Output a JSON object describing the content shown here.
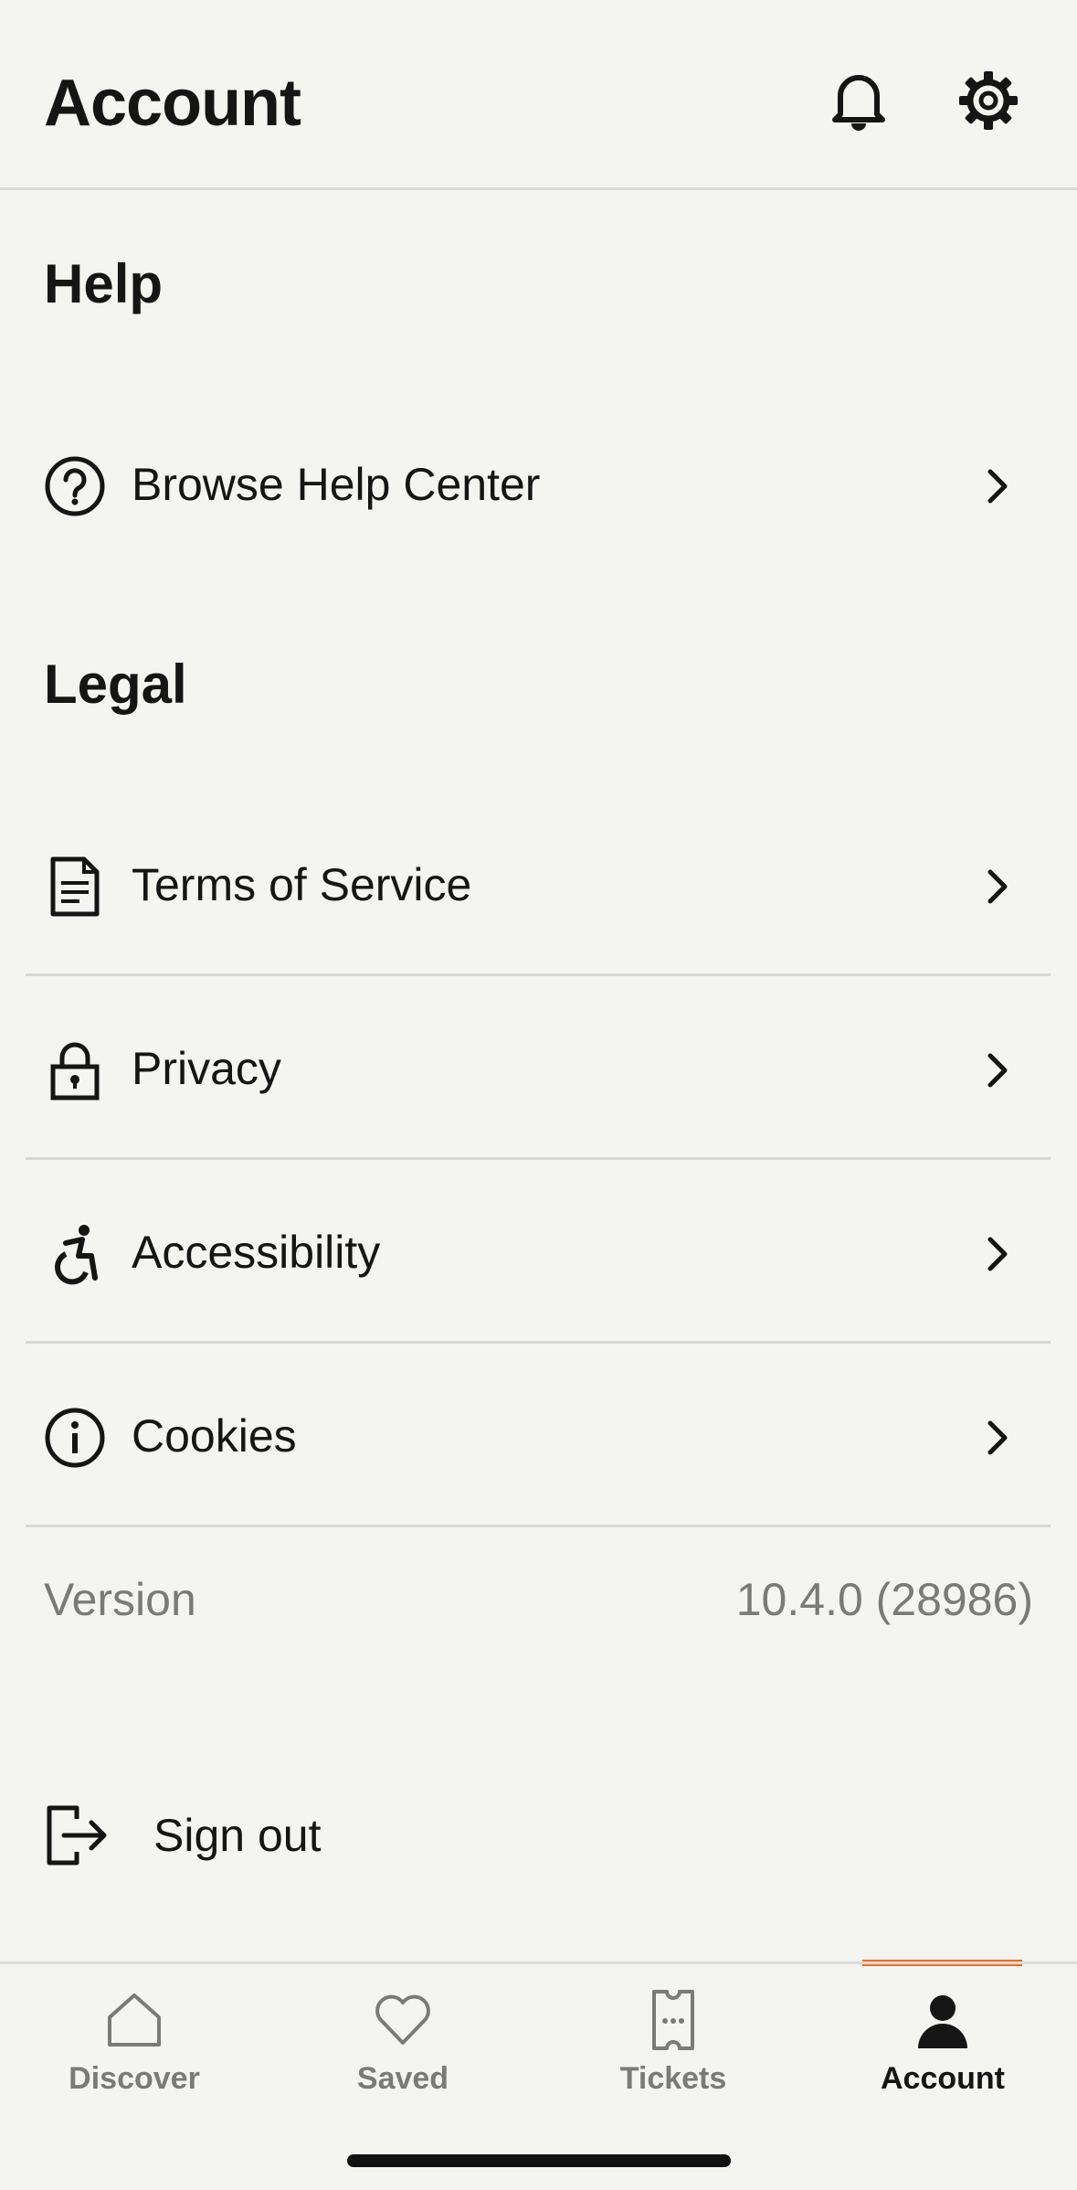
{
  "header": {
    "title": "Account",
    "icons": [
      "bell-icon",
      "gear-icon"
    ]
  },
  "help": {
    "title": "Help",
    "items": [
      {
        "label": "Browse Help Center",
        "icon": "question-circle-icon"
      }
    ]
  },
  "legal": {
    "title": "Legal",
    "items": [
      {
        "label": "Terms of Service",
        "icon": "document-icon"
      },
      {
        "label": "Privacy",
        "icon": "lock-icon"
      },
      {
        "label": "Accessibility",
        "icon": "accessibility-icon"
      },
      {
        "label": "Cookies",
        "icon": "info-circle-icon"
      }
    ]
  },
  "version": {
    "label": "Version",
    "value": "10.4.0 (28986)"
  },
  "signout": {
    "label": "Sign out",
    "icon": "sign-out-icon"
  },
  "tabbar": {
    "tabs": [
      {
        "label": "Discover",
        "icon": "home-icon"
      },
      {
        "label": "Saved",
        "icon": "heart-icon"
      },
      {
        "label": "Tickets",
        "icon": "ticket-icon"
      },
      {
        "label": "Account",
        "icon": "person-icon"
      }
    ],
    "active": "Account"
  },
  "colors": {
    "background": "#f4f4f0",
    "text": "#151515",
    "muted": "#7a7a76",
    "accent": "#f26b1d"
  }
}
